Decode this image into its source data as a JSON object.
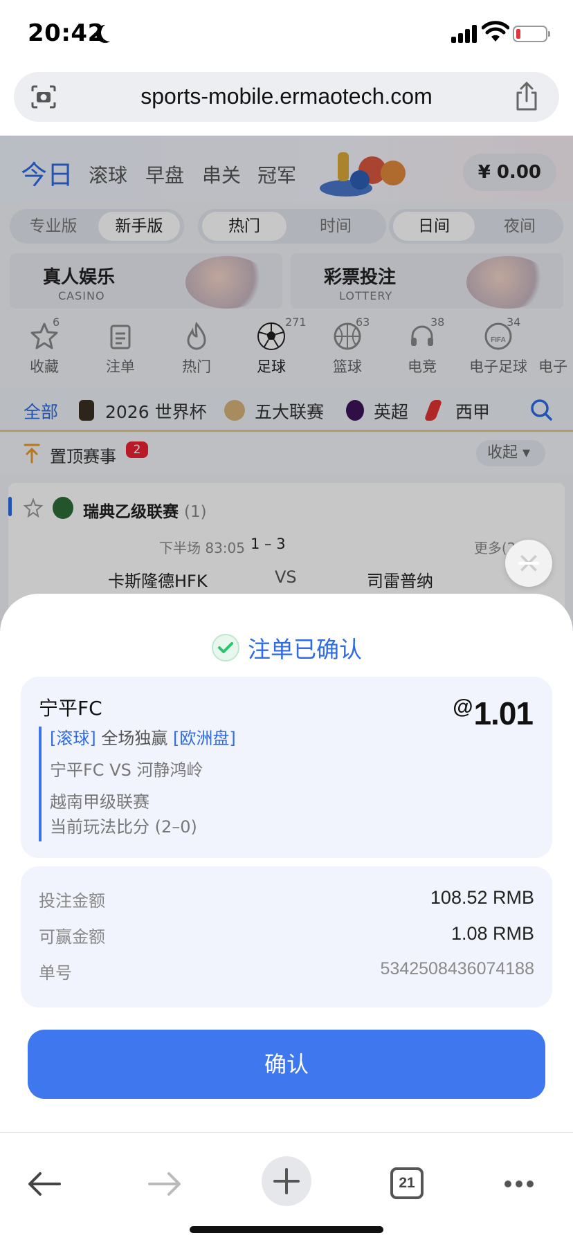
{
  "status_bar": {
    "time": "20:42"
  },
  "browser": {
    "url": "sports-mobile.ermaotech.com",
    "tab_count": "21"
  },
  "background": {
    "nav_tabs": [
      "今日",
      "滚球",
      "早盘",
      "串关",
      "冠军"
    ],
    "balance": "¥ 0.00",
    "mode_segment": [
      "专业版",
      "新手版"
    ],
    "sort_segment": [
      "热门",
      "时间"
    ],
    "daynight_segment": [
      "日间",
      "夜间"
    ],
    "promos": [
      {
        "title": "真人娱乐",
        "subtitle": "CASINO"
      },
      {
        "title": "彩票投注",
        "subtitle": "LOTTERY"
      }
    ],
    "categories": [
      {
        "label": "收藏",
        "count": "6"
      },
      {
        "label": "注单",
        "count": ""
      },
      {
        "label": "热门",
        "count": ""
      },
      {
        "label": "足球",
        "count": "271"
      },
      {
        "label": "篮球",
        "count": "63"
      },
      {
        "label": "电竞",
        "count": "38"
      },
      {
        "label": "电子足球",
        "count": "34"
      },
      {
        "label": "电子",
        "count": ""
      }
    ],
    "league_filters": [
      "全部",
      "2026 世界杯",
      "五大联赛",
      "英超",
      "西甲"
    ],
    "pinned": {
      "label": "置顶赛事",
      "badge": "2",
      "fold": "收起"
    },
    "match": {
      "league": "瑞典乙级联赛",
      "league_count": "(1)",
      "period": "下半场 83:05",
      "score": "1 – 3",
      "more": "更多(26)",
      "home": "卡斯隆德HFK",
      "vs": "VS",
      "away": "司雷普纳"
    }
  },
  "sheet": {
    "title": "注单已确认",
    "bet": {
      "team": "宁平FC",
      "odds_prefix": "@",
      "odds": "1.01",
      "type_tag": "[滚球]",
      "market": " 全场独赢 ",
      "odds_type_tag": "[欧洲盘]",
      "matchup": "宁平FC VS 河静鸿岭",
      "league": "越南甲级联赛",
      "current_score": "当前玩法比分 (2–0)"
    },
    "amounts": [
      {
        "label": "投注金额",
        "value": "108.52 RMB"
      },
      {
        "label": "可赢金额",
        "value": "1.08 RMB"
      },
      {
        "label": "单号",
        "value": "5342508436074188"
      }
    ],
    "confirm_label": "确认"
  },
  "colors": {
    "accent": "#3f78ee",
    "title_blue": "#2f6be5",
    "success_green": "#2cc36b"
  }
}
